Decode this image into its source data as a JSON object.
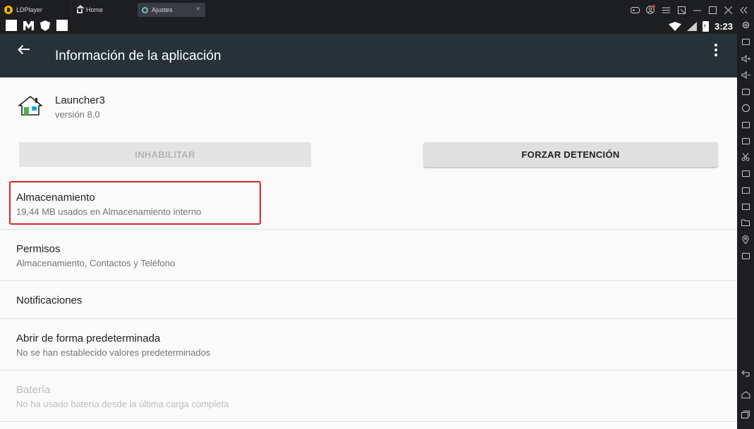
{
  "emulator": {
    "brand": "LDPlayer",
    "tabs": [
      {
        "label": "Home",
        "icon": "home-icon"
      },
      {
        "label": "Ajustes",
        "icon": "settings-icon"
      }
    ],
    "tab_close": "×",
    "controls": [
      "gamepad-icon",
      "account-icon",
      "menu-icon",
      "restore-window-icon",
      "minimize-icon",
      "maximize-icon",
      "close-icon",
      "collapse-sidebar-icon"
    ]
  },
  "status_bar": {
    "time": "3:23",
    "icons": [
      "wifi-icon",
      "no-signal-icon",
      "battery-charging-icon"
    ]
  },
  "app_bar": {
    "title": "Información de la aplicación"
  },
  "app": {
    "name": "Launcher3",
    "version": "versión 8.0"
  },
  "buttons": {
    "disable": "INHABILITAR",
    "force_stop": "FORZAR DETENCIÓN"
  },
  "settings": [
    {
      "title": "Almacenamiento",
      "subtitle": "19,44 MB usados en Almacenamiento interno"
    },
    {
      "title": "Permisos",
      "subtitle": "Almacenamiento, Contactos y Teléfono"
    },
    {
      "title": "Notificaciones",
      "subtitle": ""
    },
    {
      "title": "Abrir de forma predeterminada",
      "subtitle": "No se han establecido valores predeterminados"
    },
    {
      "title": "Batería",
      "subtitle": "No ha usado batería desde la última carga completa"
    }
  ],
  "colors": {
    "app_bar": "#263238",
    "status_bar": "#1d1f21",
    "emulator_chrome": "#1d1e22",
    "highlight": "#d9262a"
  }
}
